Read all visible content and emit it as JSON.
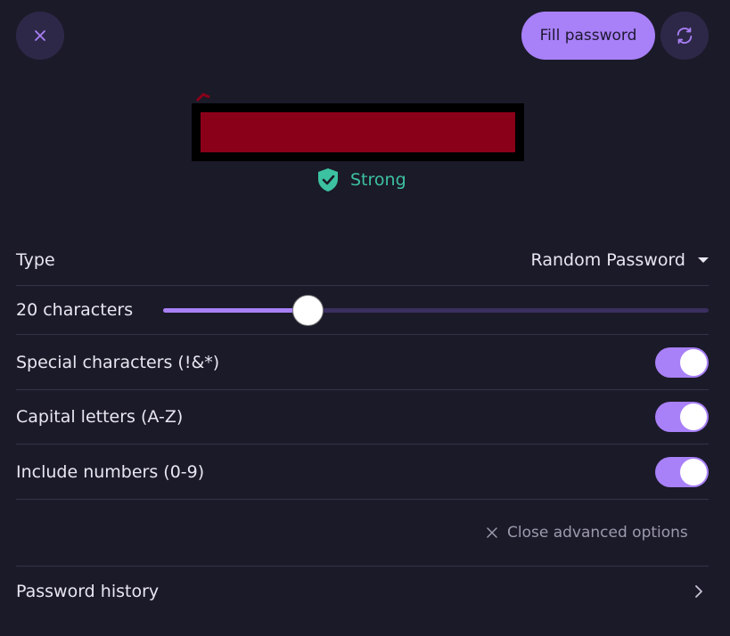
{
  "header": {
    "close_icon": "close-icon",
    "fill_label": "Fill password",
    "refresh_icon": "refresh-icon"
  },
  "strength": {
    "label": "Strong",
    "color": "#3cc2a0",
    "icon": "shield-check-icon"
  },
  "options": {
    "type_label": "Type",
    "type_value": "Random Password",
    "length_label": "20 characters",
    "length_slider_fraction": 0.265,
    "special_label": "Special characters (!&*)",
    "special_enabled": true,
    "caps_label": "Capital letters (A-Z)",
    "caps_enabled": true,
    "numbers_label": "Include numbers (0-9)",
    "numbers_enabled": true
  },
  "advanced": {
    "label": "Close advanced options"
  },
  "history": {
    "label": "Password history"
  },
  "colors": {
    "accent": "#a880f7",
    "background": "#1b1a29",
    "redaction": "#8b0019"
  }
}
